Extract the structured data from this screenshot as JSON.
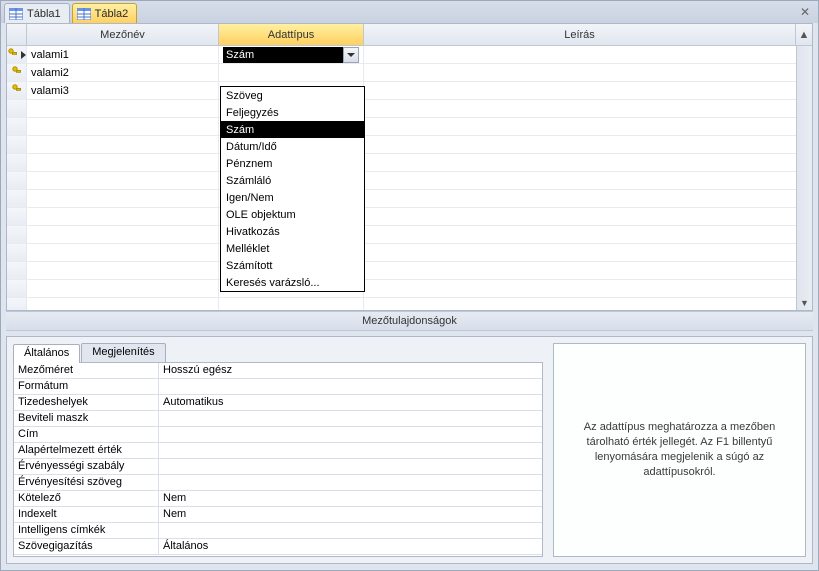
{
  "tabs": [
    {
      "label": "Tábla1"
    },
    {
      "label": "Tábla2"
    }
  ],
  "activeTab": 1,
  "gridHeaders": {
    "name": "Mezőnév",
    "type": "Adattípus",
    "desc": "Leírás"
  },
  "fields": [
    {
      "name": "valami1",
      "type": "Szám",
      "desc": ""
    },
    {
      "name": "valami2",
      "type": "",
      "desc": ""
    },
    {
      "name": "valami3",
      "type": "",
      "desc": ""
    }
  ],
  "dropdown": {
    "selectedValue": "Szám",
    "options": [
      "Szöveg",
      "Feljegyzés",
      "Szám",
      "Dátum/Idő",
      "Pénznem",
      "Számláló",
      "Igen/Nem",
      "OLE objektum",
      "Hivatkozás",
      "Melléklet",
      "Számított",
      "Keresés varázsló..."
    ],
    "highlightedIndex": 2
  },
  "sectionTitle": "Mezőtulajdonságok",
  "propTabs": [
    {
      "label": "Általános"
    },
    {
      "label": "Megjelenítés"
    }
  ],
  "activePropTab": 0,
  "properties": [
    {
      "label": "Mezőméret",
      "value": "Hosszú egész"
    },
    {
      "label": "Formátum",
      "value": ""
    },
    {
      "label": "Tizedeshelyek",
      "value": "Automatikus"
    },
    {
      "label": "Beviteli maszk",
      "value": ""
    },
    {
      "label": "Cím",
      "value": ""
    },
    {
      "label": "Alapértelmezett érték",
      "value": ""
    },
    {
      "label": "Érvényességi szabály",
      "value": ""
    },
    {
      "label": "Érvényesítési szöveg",
      "value": ""
    },
    {
      "label": "Kötelező",
      "value": "Nem"
    },
    {
      "label": "Indexelt",
      "value": "Nem"
    },
    {
      "label": "Intelligens címkék",
      "value": ""
    },
    {
      "label": "Szövegigazítás",
      "value": "Általános"
    }
  ],
  "helpText": "Az adattípus meghatározza a mezőben tárolható érték jellegét. Az F1 billentyű lenyomására megjelenik a súgó az adattípusokról."
}
